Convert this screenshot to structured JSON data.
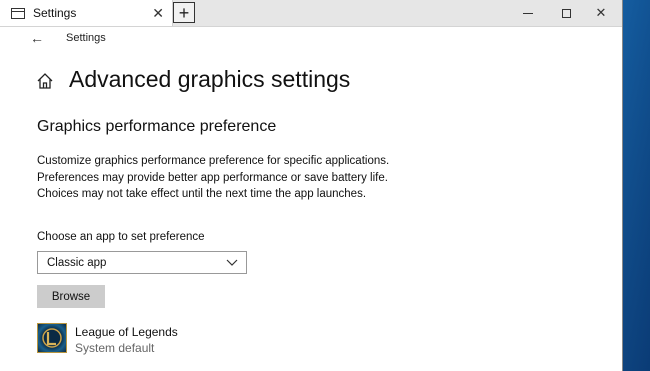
{
  "window": {
    "tab_title": "Settings",
    "tab_close": "✕",
    "new_tab": "+",
    "close_glyph": "✕"
  },
  "nav": {
    "back_glyph": "←",
    "title": "Settings"
  },
  "page": {
    "title": "Advanced graphics settings",
    "section_title": "Graphics performance preference",
    "description": "Customize graphics performance preference for specific applications. Preferences may provide better app performance or save battery life. Choices may not take effect until the next time the app launches.",
    "choose_label": "Choose an app to set preference",
    "select_value": "Classic app",
    "browse_label": "Browse"
  },
  "apps": [
    {
      "name": "League of Legends",
      "preference": "System default",
      "icon": "league-of-legends-icon"
    }
  ],
  "colors": {
    "window_bg": "#ffffff",
    "titlebar_bg": "#e6e6e6",
    "button_bg": "#cccccc",
    "desktop_bg": "#0a4a86"
  }
}
